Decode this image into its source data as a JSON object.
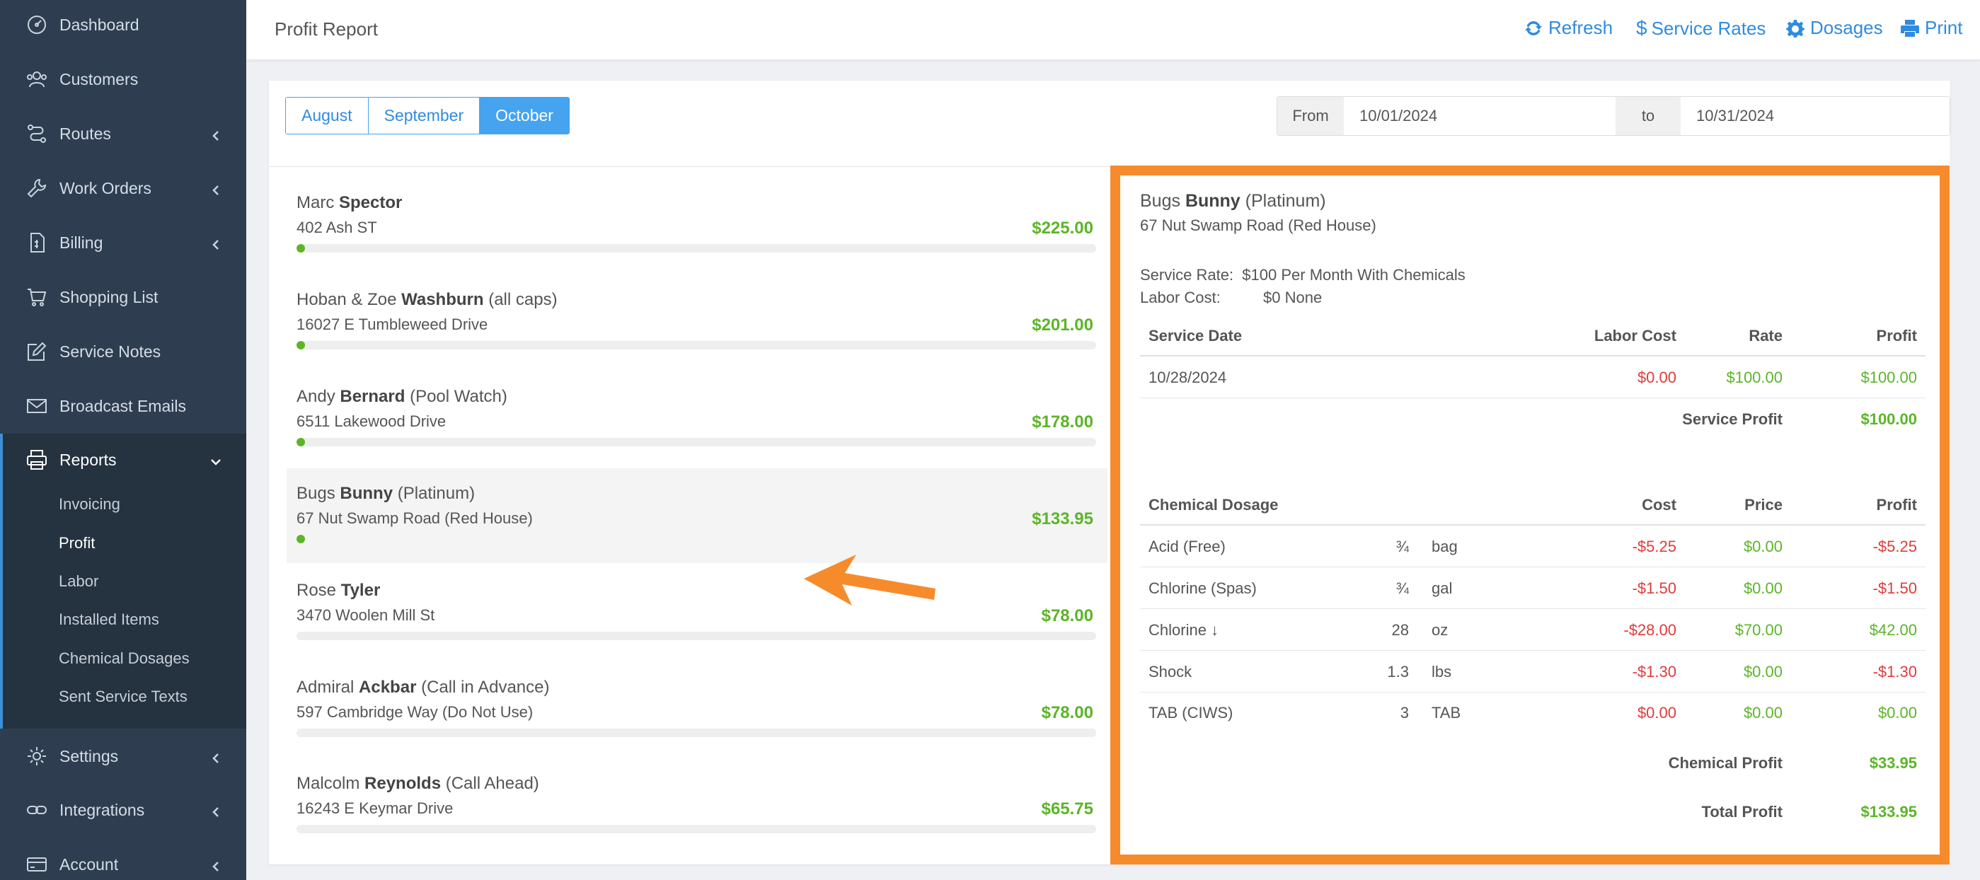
{
  "sidebar": {
    "items": [
      {
        "label": "Dashboard",
        "icon": "dashboard-icon"
      },
      {
        "label": "Customers",
        "icon": "users-icon"
      },
      {
        "label": "Routes",
        "icon": "route-icon"
      },
      {
        "label": "Work Orders",
        "icon": "wrench-icon"
      },
      {
        "label": "Billing",
        "icon": "invoice-icon"
      },
      {
        "label": "Shopping List",
        "icon": "cart-icon"
      },
      {
        "label": "Service Notes",
        "icon": "edit-icon"
      },
      {
        "label": "Broadcast Emails",
        "icon": "envelope-icon"
      },
      {
        "label": "Reports",
        "icon": "printer-icon"
      },
      {
        "label": "Settings",
        "icon": "gear-icon"
      },
      {
        "label": "Integrations",
        "icon": "link-icon"
      },
      {
        "label": "Account",
        "icon": "card-icon"
      }
    ],
    "reports_sub": [
      "Invoicing",
      "Profit",
      "Labor",
      "Installed Items",
      "Chemical Dosages",
      "Sent Service Texts"
    ]
  },
  "header": {
    "title": "Profit Report",
    "actions": {
      "refresh": "Refresh",
      "rates": "Service Rates",
      "dosages": "Dosages",
      "print": "Print"
    }
  },
  "months": [
    "August",
    "September",
    "October"
  ],
  "active_month": "October",
  "range": {
    "from_label": "From",
    "from": "10/01/2024",
    "to_label": "to",
    "to": "10/31/2024"
  },
  "customers": [
    {
      "first": "Marc",
      "last": "Spector",
      "suffix": "",
      "addr": "402 Ash ST",
      "amount": "$225.00",
      "progress": 0.01
    },
    {
      "first": "Hoban & Zoe",
      "last": "Washburn",
      "suffix": "(all caps)",
      "addr": "16027 E Tumbleweed Drive",
      "amount": "$201.00",
      "progress": 0.01
    },
    {
      "first": "Andy",
      "last": "Bernard",
      "suffix": "(Pool Watch)",
      "addr": "6511 Lakewood Drive",
      "amount": "$178.00",
      "progress": 0.01
    },
    {
      "first": "Bugs",
      "last": "Bunny",
      "suffix": "(Platinum)",
      "addr": "67 Nut Swamp Road (Red House)",
      "amount": "$133.95",
      "progress": 0.01
    },
    {
      "first": "Rose",
      "last": "Tyler",
      "suffix": "",
      "addr": "3470 Woolen Mill St",
      "amount": "$78.00",
      "progress": 0
    },
    {
      "first": "Admiral",
      "last": "Ackbar",
      "suffix": "(Call in Advance)",
      "addr": "597 Cambridge Way (Do Not Use)",
      "amount": "$78.00",
      "progress": 0
    },
    {
      "first": "Malcolm",
      "last": "Reynolds",
      "suffix": "(Call Ahead)",
      "addr": "16243 E Keymar Drive",
      "amount": "$65.75",
      "progress": 0
    }
  ],
  "detail": {
    "first": "Bugs",
    "last": "Bunny",
    "suffix": "(Platinum)",
    "addr": "67 Nut Swamp Road (Red House)",
    "service_rate_label": "Service Rate:",
    "service_rate": "$100 Per Month With Chemicals",
    "labor_cost_label": "Labor Cost:",
    "labor_cost": "$0 None",
    "service_headers": {
      "date": "Service Date",
      "labor": "Labor Cost",
      "rate": "Rate",
      "profit": "Profit"
    },
    "services": [
      {
        "date": "10/28/2024",
        "labor": "$0.00",
        "rate": "$100.00",
        "profit": "$100.00"
      }
    ],
    "service_profit_label": "Service Profit",
    "service_profit": "$100.00",
    "chem_headers": {
      "name": "Chemical Dosage",
      "cost": "Cost",
      "price": "Price",
      "profit": "Profit"
    },
    "chemicals": [
      {
        "name": "Acid (Free)",
        "qty": "¾",
        "unit": "bag",
        "cost": "-$5.25",
        "price": "$0.00",
        "profit": "-$5.25",
        "neg": true
      },
      {
        "name": "Chlorine (Spas)",
        "qty": "¾",
        "unit": "gal",
        "cost": "-$1.50",
        "price": "$0.00",
        "profit": "-$1.50",
        "neg": true
      },
      {
        "name": "Chlorine ↓",
        "qty": "28",
        "unit": "oz",
        "cost": "-$28.00",
        "price": "$70.00",
        "profit": "$42.00",
        "neg": false
      },
      {
        "name": "Shock",
        "qty": "1.3",
        "unit": "lbs",
        "cost": "-$1.30",
        "price": "$0.00",
        "profit": "-$1.30",
        "neg": true
      },
      {
        "name": "TAB (CIWS)",
        "qty": "3",
        "unit": "TAB",
        "cost": "$0.00",
        "price": "$0.00",
        "profit": "$0.00",
        "neg": false
      }
    ],
    "chem_profit_label": "Chemical Profit",
    "chem_profit": "$33.95",
    "total_profit_label": "Total Profit",
    "total_profit": "$133.95"
  },
  "colors": {
    "accent": "#2f8be0",
    "highlight": "#f68b2c",
    "positive": "#5bb527",
    "negative": "#e03b3b",
    "sidebar": "#2e3e50"
  }
}
